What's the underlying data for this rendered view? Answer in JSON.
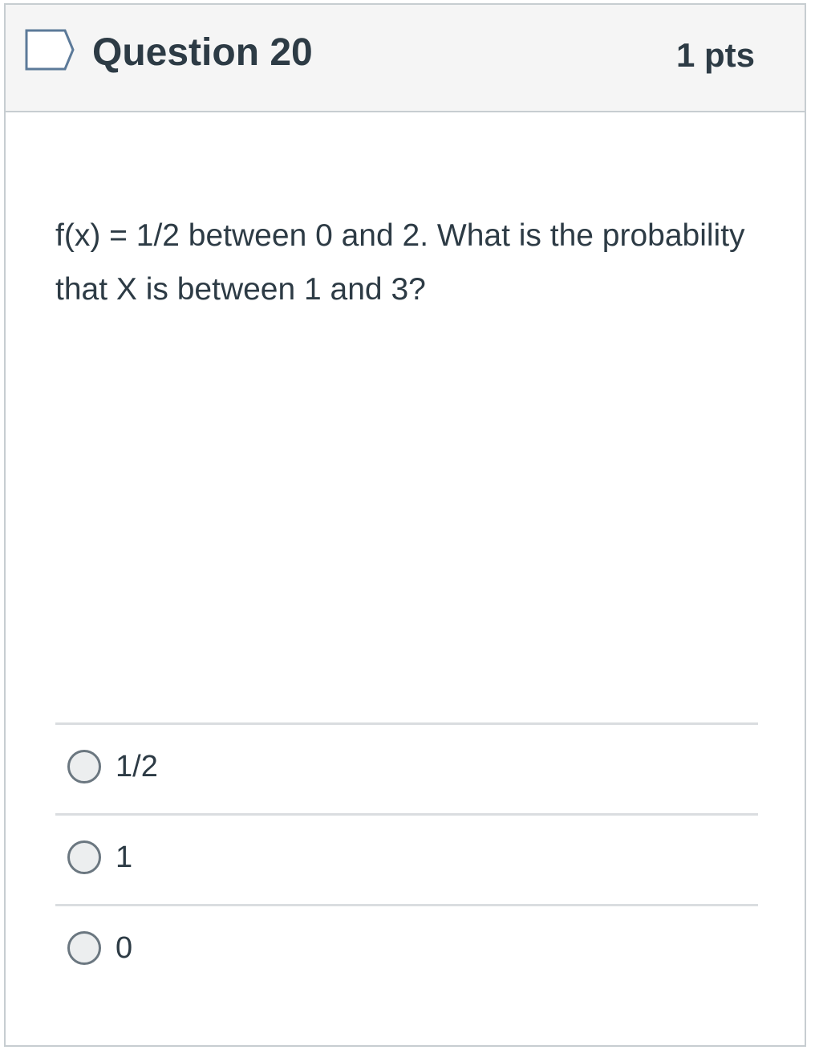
{
  "question": {
    "title": "Question 20",
    "points": "1 pts",
    "flag_icon": "flag-outline-icon",
    "text": "f(x) = 1/2 between 0 and 2. What is the probability that X is between 1 and 3?"
  },
  "answers": [
    {
      "label": "1/2",
      "selected": false
    },
    {
      "label": "1",
      "selected": false
    },
    {
      "label": "0",
      "selected": false
    }
  ],
  "colors": {
    "header_bg": "#f5f5f5",
    "border": "#c7cdd1",
    "text": "#2d3b45",
    "flag_stroke": "#5c7a99"
  }
}
